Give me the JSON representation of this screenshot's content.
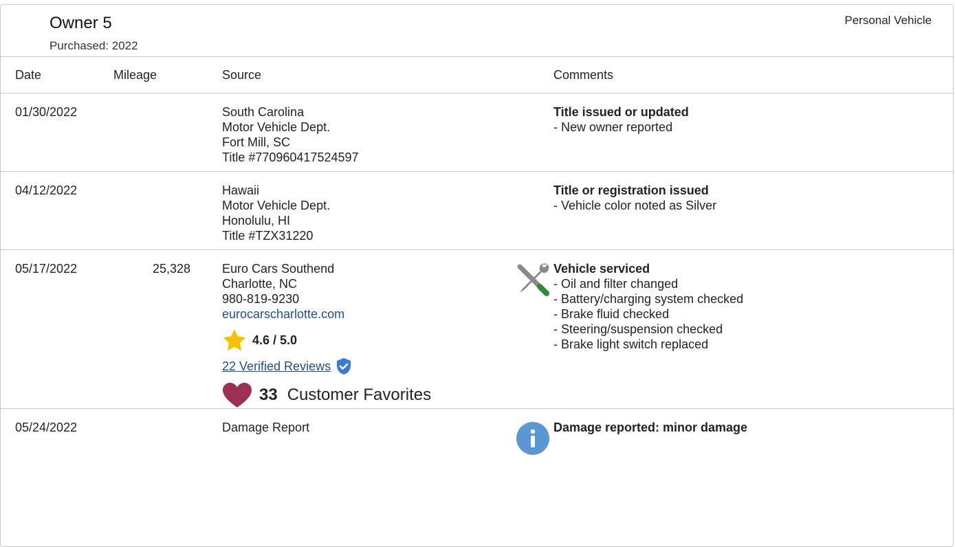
{
  "owner": {
    "title": "Owner 5",
    "purchased": "Purchased: 2022",
    "vehicle_type": "Personal Vehicle"
  },
  "columns": {
    "date": "Date",
    "mileage": "Mileage",
    "source": "Source",
    "comments": "Comments"
  },
  "records": [
    {
      "date": "01/30/2022",
      "mileage": "",
      "source": [
        "South Carolina",
        "Motor Vehicle Dept.",
        "Fort Mill, SC",
        "Title #770960417524597"
      ],
      "comment_title": "Title issued or updated",
      "comment_lines": [
        "- New owner reported"
      ]
    },
    {
      "date": "04/12/2022",
      "mileage": "",
      "source": [
        "Hawaii",
        "Motor Vehicle Dept.",
        "Honolulu, HI",
        "Title #TZX31220"
      ],
      "comment_title": "Title or registration issued",
      "comment_lines": [
        "- Vehicle color noted as Silver"
      ]
    },
    {
      "date": "05/17/2022",
      "mileage": "25,328",
      "source": [
        "Euro Cars Southend",
        "Charlotte, NC",
        "980-819-9230"
      ],
      "website": "eurocarscharlotte.com",
      "rating": "4.6 / 5.0",
      "reviews": "22 Verified Reviews",
      "favorites_count": "33",
      "favorites_label": "Customer Favorites",
      "icon": "service-tools-icon",
      "comment_title": "Vehicle serviced",
      "comment_lines": [
        "- Oil and filter changed",
        "- Battery/charging system checked",
        "- Brake fluid checked",
        "- Steering/suspension checked",
        "- Brake light switch replaced"
      ]
    },
    {
      "date": "05/24/2022",
      "mileage": "",
      "source": [
        "Damage Report"
      ],
      "icon": "info-icon",
      "comment_title": "Damage reported: minor damage",
      "comment_lines": []
    }
  ],
  "colors": {
    "link": "#1f4f8c",
    "star": "#f6c200",
    "heart": "#9e2f54",
    "info": "#5b97d0",
    "verified": "#3a7bd5",
    "wrench_green": "#2e8b3a"
  }
}
